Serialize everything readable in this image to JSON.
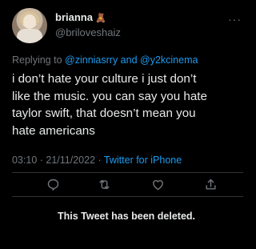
{
  "author": {
    "name": "brianna",
    "name_emoji": "🧸",
    "handle": "@briloveshaiz"
  },
  "reply": {
    "prefix": "Replying to",
    "users": "@zinniasrry and @y2kcinema"
  },
  "tweet": {
    "text": "i don’t hate your culture i just don’t\nlike the music. you can say you hate\ntaylor swift, that doesn’t mean you\nhate americans"
  },
  "meta": {
    "datetime": "03:10 · 21/11/2022 ·",
    "client": "Twitter for iPhone"
  },
  "actions": [
    "reply-icon",
    "retweet-icon",
    "like-icon",
    "share-icon"
  ],
  "notice": {
    "deleted_text": "This Tweet has been deleted."
  },
  "colors": {
    "background": "#000000",
    "text": "#e7e9ea",
    "muted": "#71767b",
    "accent": "#1d9bf0",
    "divider": "#2f3336"
  }
}
